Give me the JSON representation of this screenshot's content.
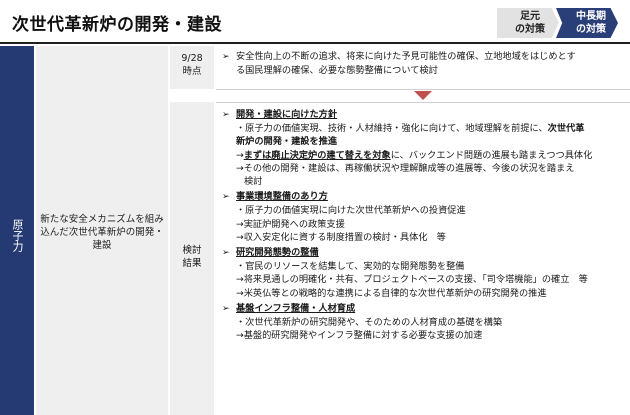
{
  "title": "次世代革新炉の開発・建設",
  "tabs": [
    {
      "line1": "足元",
      "line2": "の対策"
    },
    {
      "line1": "中長期",
      "line2": "の対策"
    }
  ],
  "category": "原子力",
  "item": "新たな安全メカニズムを組み込んだ次世代革新炉の開発・建設",
  "top_row": {
    "date": {
      "line1": "9/28",
      "line2": "時点"
    },
    "marker": "➢",
    "line1": "安全性向上の不断の追求、将来に向けた予見可能性の確保、立地地域をはじめとす",
    "line2": "る国民理解の確保、必要な態勢整備について検討"
  },
  "result_label": {
    "line1": "検討",
    "line2": "結果"
  },
  "sections": {
    "s1": {
      "marker": "➢",
      "heading": "開発・建設に向けた方針",
      "p1a": "・原子力の価値実現、技術・人材維持・強化に向けて、地域理解を前提に、",
      "p1b": "次世代革",
      "p1c": "新炉の開発・建設を推進",
      "p2a": "→",
      "p2b": "まずは廃止決定炉の建て替えを対象",
      "p2c": "に、バックエンド問題の進展も踏まえつつ具体化",
      "p3a": "→その他の開発・建設は、再稼働状況や理解醸成等の進展等、今後の状況を踏まえ",
      "p3b": "検討"
    },
    "s2": {
      "marker": "➢",
      "heading": "事業環境整備のあり方",
      "l1": "・原子力の価値実現に向けた次世代革新炉への投資促進",
      "l2": "→実証炉開発への政策支援",
      "l3": "→収入安定化に資する制度措置の検討・具体化　等"
    },
    "s3": {
      "marker": "➢",
      "heading": "研究開発態勢の整備",
      "l1": "・官民のリソースを結集して、実効的な開発態勢を整備",
      "l2": "→将来見通しの明確化・共有、プロジェクトベースの支援、「司令塔機能」の確立　等",
      "l3": "→米英仏等との戦略的な連携による自律的な次世代革新炉の研究開発の推進"
    },
    "s4": {
      "marker": "➢",
      "heading": "基盤インフラ整備・人材育成",
      "l1": "・次世代革新炉の研究開発や、そのための人材育成の基礎を構築",
      "l2": "→基盤的研究開発やインフラ整備に対する必要な支援の加速"
    }
  },
  "colors": {
    "navy": "#253a72",
    "arrow": "#c0504d",
    "panel": "#efefef"
  }
}
